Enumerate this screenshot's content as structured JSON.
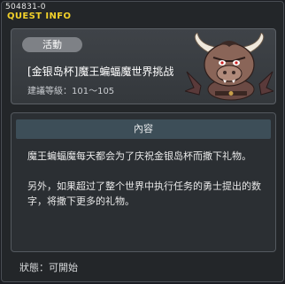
{
  "window": {
    "quest_id": "504831-0",
    "title": "QUEST INFO"
  },
  "header": {
    "category": "活動",
    "quest_name": "[金银岛杯]魔王蝙蝠魔世界挑战",
    "level_range": "建議等級：101～105",
    "portrait_icon": "bat-demon-portrait-icon"
  },
  "content": {
    "section_title": "內容",
    "paragraphs": [
      "魔王蝙蝠魔每天都会为了庆祝金银岛杯而撒下礼物。",
      "另外，如果超过了整个世界中执行任务的勇士提出的数字，将撒下更多的礼物。"
    ]
  },
  "status": {
    "text": "狀態：可開始"
  },
  "colors": {
    "title_yellow": "#f2d12a",
    "panel_bg": "#2b2f33",
    "section_header_bg": "#3d4e58"
  }
}
